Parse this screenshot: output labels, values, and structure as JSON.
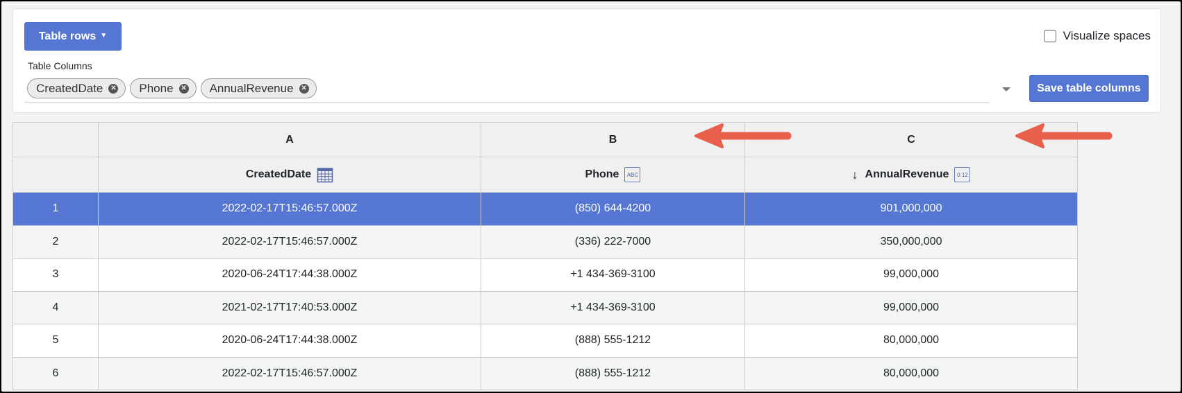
{
  "toolbar": {
    "table_rows_label": "Table rows",
    "visualize_spaces_label": "Visualize spaces",
    "visualize_spaces_checked": false,
    "table_columns_label": "Table Columns",
    "selected_columns": [
      "CreatedDate",
      "Phone",
      "AnnualRevenue"
    ],
    "save_label": "Save table columns"
  },
  "grid": {
    "column_letters": [
      "A",
      "B",
      "C"
    ],
    "fields": [
      {
        "name": "CreatedDate",
        "type_icon": "calendar-icon"
      },
      {
        "name": "Phone",
        "type_icon": "text-type-icon",
        "icon_text": "ABC"
      },
      {
        "name": "AnnualRevenue",
        "type_icon": "number-type-icon",
        "icon_text": "0.12",
        "sorted": "descending"
      }
    ],
    "rows": [
      {
        "num": "1",
        "CreatedDate": "2022-02-17T15:46:57.000Z",
        "Phone": "(850) 644-4200",
        "AnnualRevenue": "901,000,000"
      },
      {
        "num": "2",
        "CreatedDate": "2022-02-17T15:46:57.000Z",
        "Phone": "(336) 222-7000",
        "AnnualRevenue": "350,000,000"
      },
      {
        "num": "3",
        "CreatedDate": "2020-06-24T17:44:38.000Z",
        "Phone": "+1 434-369-3100",
        "AnnualRevenue": "99,000,000"
      },
      {
        "num": "4",
        "CreatedDate": "2021-02-17T17:40:53.000Z",
        "Phone": "+1 434-369-3100",
        "AnnualRevenue": "99,000,000"
      },
      {
        "num": "5",
        "CreatedDate": "2020-06-24T17:44:38.000Z",
        "Phone": "(888) 555-1212",
        "AnnualRevenue": "80,000,000"
      },
      {
        "num": "6",
        "CreatedDate": "2022-02-17T15:46:57.000Z",
        "Phone": "(888) 555-1212",
        "AnnualRevenue": "80,000,000"
      }
    ],
    "selected_row": "1"
  },
  "colors": {
    "primary": "#5577d3",
    "annotation_arrow": "#e8604c"
  }
}
